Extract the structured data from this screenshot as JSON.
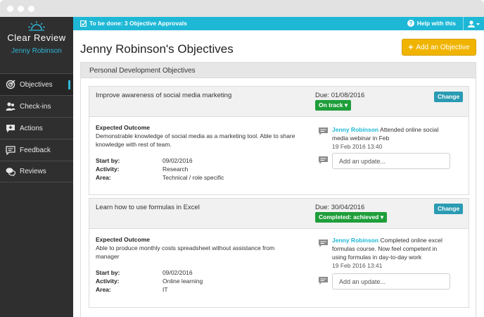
{
  "app": {
    "name": "Clear Review",
    "user": "Jenny Robinson"
  },
  "nav": [
    {
      "label": "Objectives",
      "icon": "target-icon",
      "active": true
    },
    {
      "label": "Check-ins",
      "icon": "people-icon"
    },
    {
      "label": "Actions",
      "icon": "actions-icon"
    },
    {
      "label": "Feedback",
      "icon": "feedback-icon"
    },
    {
      "label": "Reviews",
      "icon": "reviews-icon"
    }
  ],
  "topbar": {
    "todo": "To be done: 3 Objective Approvals",
    "help": "Help with this"
  },
  "page": {
    "title": "Jenny Robinson's Objectives",
    "add_button": "Add an Objective"
  },
  "panel": {
    "title": "Personal Development Objectives"
  },
  "labels": {
    "expected_outcome": "Expected Outcome",
    "start_by": "Start by:",
    "activity": "Activity:",
    "area": "Area:",
    "change": "Change",
    "update_placeholder": "Add an update..."
  },
  "objectives": [
    {
      "title": "Improve awareness of social media marketing",
      "due": "Due: 01/08/2016",
      "status": "On track",
      "outcome": "Demonstrable knowledge of social media as a marketing tool. Able to share knowledge with rest of team.",
      "start_by": "09/02/2016",
      "activity": "Research",
      "area": "Technical / role specific",
      "comment": {
        "author": "Jenny Robinson",
        "text": "Attended online social media webinar in Feb",
        "time": "19 Feb 2016 13:40"
      }
    },
    {
      "title": "Learn how to use formulas in Excel",
      "due": "Due: 30/04/2016",
      "status": "Completed: achieved",
      "outcome": "Able to produce monthly costs spreadsheet without assistance from manager",
      "start_by": "09/02/2016",
      "activity": "Online learning",
      "area": "IT",
      "comment": {
        "author": "Jenny Robinson",
        "text": "Completed online excel formulas course. Now feel competent in using formulas in day-to-day work",
        "time": "19 Feb 2016 13:41"
      }
    }
  ],
  "colors": {
    "accent": "#1eb8d6",
    "sidebar": "#2f2f2f",
    "add_button": "#f0b400",
    "status_green": "#1e9e3a",
    "change_button": "#2a9bb3"
  }
}
